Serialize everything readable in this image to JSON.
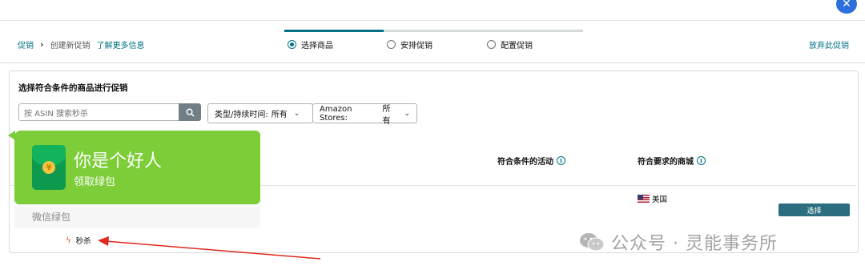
{
  "header": {
    "breadcrumb": {
      "root": "促销",
      "current": "创建新促销",
      "learn_more": "了解更多信息"
    },
    "steps": [
      {
        "label": "选择商品",
        "active": true
      },
      {
        "label": "安排促销",
        "active": false
      },
      {
        "label": "配置促销",
        "active": false
      }
    ],
    "abandon": "放弃此促销"
  },
  "panel": {
    "title": "选择符合条件的商品进行促销",
    "search": {
      "placeholder": "按 ASIN 搜索秒杀"
    },
    "filters": {
      "type_duration": {
        "label": "类型/持续时间:",
        "value": "所有"
      },
      "stores": {
        "label": "Amazon Stores:",
        "value": "所有"
      }
    },
    "columns": {
      "eligible_activities": "符合条件的活动",
      "required_stores": "符合要求的商城"
    },
    "row": {
      "store": "美国",
      "deal_type": "秒杀",
      "select_button": "选择"
    }
  },
  "overlay": {
    "title": "你是个好人",
    "subtitle": "领取绿包",
    "footer": "微信绿包",
    "coin_symbol": "¥"
  },
  "watermark": {
    "text": "公众号 · 灵能事务所"
  },
  "colors": {
    "accent": "#007185",
    "select_button": "#2b6e80",
    "overlay_green": "#7ccd38",
    "close_button": "#2a6fdb",
    "arrow": "#e0291f"
  }
}
